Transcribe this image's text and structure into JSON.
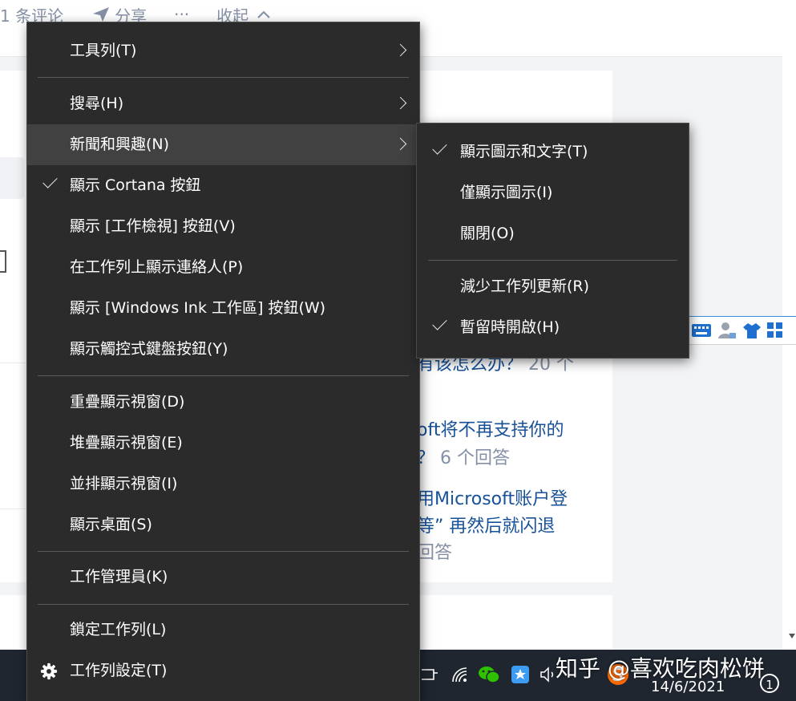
{
  "top_actions": [
    {
      "icon": "comment-icon",
      "label": "1 条评论"
    },
    {
      "icon": "share-icon",
      "label": "分享"
    },
    {
      "icon": "more-icon",
      "label": "···"
    },
    {
      "icon": "chevron-up-icon",
      "label": "收起"
    }
  ],
  "related_questions": [
    {
      "line1": "有该怎么办？",
      "count": "20 个"
    },
    {
      "line1": "oft将不再支持你的",
      "line2": "？",
      "count": "6 个回答"
    },
    {
      "line1": "用Microsoft账户登",
      "line2": "等” 再然后就闪退",
      "count": "回答"
    }
  ],
  "taskbar_menu": {
    "items": [
      {
        "label": "工具列(T)",
        "submenu": true
      },
      {
        "label": "搜尋(H)",
        "submenu": true
      },
      {
        "label": "新聞和興趣(N)",
        "submenu": true,
        "highlighted": true
      },
      {
        "label": "顯示 Cortana 按鈕",
        "checked": true
      },
      {
        "label": "顯示 [工作檢視] 按鈕(V)"
      },
      {
        "label": "在工作列上顯示連絡人(P)"
      },
      {
        "label": "顯示 [Windows Ink 工作區] 按鈕(W)"
      },
      {
        "label": "顯示觸控式鍵盤按鈕(Y)"
      },
      {
        "label": "重疊顯示視窗(D)"
      },
      {
        "label": "堆疊顯示視窗(E)"
      },
      {
        "label": "並排顯示視窗(I)"
      },
      {
        "label": "顯示桌面(S)"
      },
      {
        "label": "工作管理員(K)"
      },
      {
        "label": "鎖定工作列(L)"
      },
      {
        "label": "工作列設定(T)",
        "icon": "gear-icon"
      }
    ]
  },
  "news_submenu": {
    "items": [
      {
        "label": "顯示圖示和文字(T)",
        "checked": true
      },
      {
        "label": "僅顯示圖示(I)"
      },
      {
        "label": "關閉(O)"
      },
      {
        "label": "減少工作列更新(R)"
      },
      {
        "label": "暫留時開啟(H)",
        "checked": true
      }
    ]
  },
  "taskbar": {
    "watermark": "知乎 @喜欢吃肉松饼",
    "date": "14/6/2021",
    "notification_count": "1"
  },
  "colors": {
    "menu_bg": "#2b2b2b",
    "menu_highlight": "#414141",
    "taskbar_bg": "#1f2630",
    "link_blue": "#175199",
    "meta_gray": "#8590a6"
  }
}
